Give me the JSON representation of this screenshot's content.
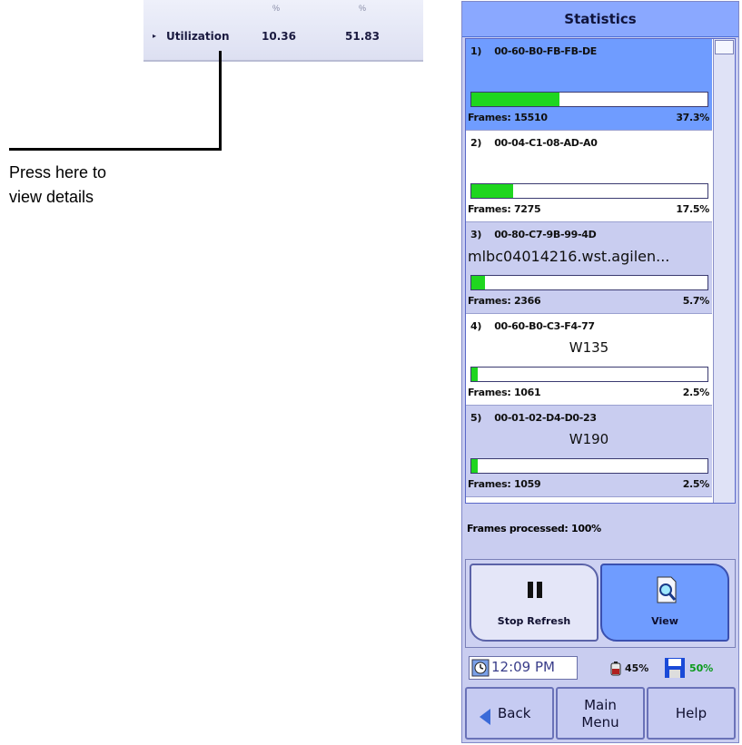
{
  "utilization": {
    "header_col1": "%",
    "header_col2": "%",
    "label": "Utilization",
    "value1": "10.36",
    "value2": "51.83"
  },
  "callout": {
    "line1": "Press here to",
    "line2": "view details"
  },
  "panel": {
    "title": "Statistics",
    "entries": [
      {
        "address": "1)    00-60-B0-FB-FB-DE",
        "hostname": "",
        "frames": "Frames: 15510",
        "percent": "37.3%",
        "fill_fraction": 0.373,
        "selected": true
      },
      {
        "address": "2)    00-04-C1-08-AD-A0",
        "hostname": "",
        "frames": "Frames: 7275",
        "percent": "17.5%",
        "fill_fraction": 0.175,
        "selected": false
      },
      {
        "address": "3)    00-80-C7-9B-99-4D",
        "hostname": "mlbc04014216.wst.agilen...",
        "frames": "Frames: 2366",
        "percent": "5.7%",
        "fill_fraction": 0.057,
        "selected": false
      },
      {
        "address": "4)    00-60-B0-C3-F4-77",
        "hostname": "W135",
        "frames": "Frames: 1061",
        "percent": "2.5%",
        "fill_fraction": 0.025,
        "selected": false
      },
      {
        "address": "5)    00-01-02-D4-D0-23",
        "hostname": "W190",
        "frames": "Frames: 1059",
        "percent": "2.5%",
        "fill_fraction": 0.025,
        "selected": false
      }
    ],
    "frames_processed": "Frames processed: 100%",
    "stop_refresh_label": "Stop Refresh",
    "view_label": "View",
    "clock_time": "12:09 PM",
    "battery_percent": "45%",
    "disk_percent": "50%",
    "nav_back": "Back",
    "nav_main_line1": "Main",
    "nav_main_line2": "Menu",
    "nav_help": "Help"
  },
  "colors": {
    "title_bar": "#8aa8ff",
    "selected_row": "#6f9cff",
    "alt_row": "#c9cdf0",
    "bar_fill": "#1fd61f",
    "disk_text": "#0a9a1a"
  }
}
